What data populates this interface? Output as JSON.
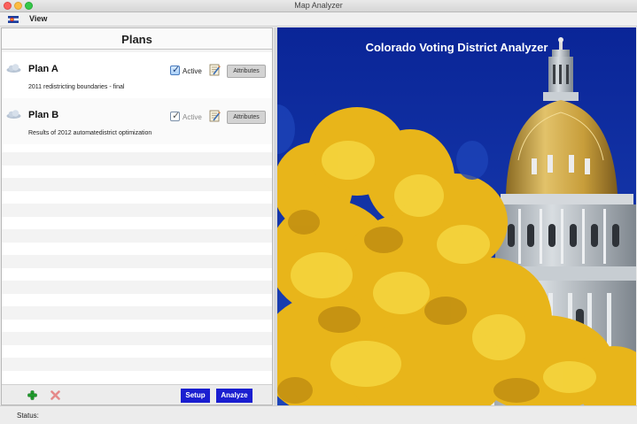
{
  "window": {
    "title": "Map Analyzer"
  },
  "menu": {
    "items": [
      "View"
    ]
  },
  "plans_panel": {
    "title": "Plans",
    "plans": [
      {
        "name": "Plan A",
        "description": "2011 redistricting boundaries - final",
        "active_label": "Active",
        "active": true,
        "attributes_label": "Attributes"
      },
      {
        "name": "Plan B",
        "description": "Results of 2012 automatedistrict optimization",
        "active_label": "Active",
        "active": true,
        "attributes_label": "Attributes"
      }
    ],
    "setup_label": "Setup",
    "analyze_label": "Analyze"
  },
  "image_panel": {
    "title": "Colorado Voting District Analyzer"
  },
  "status": {
    "label": "Status:"
  },
  "colors": {
    "accent_button": "#1a1ed0",
    "sky": "#0f2e9e",
    "foliage": "#e6b417",
    "dome_gold": "#c9a23c"
  }
}
